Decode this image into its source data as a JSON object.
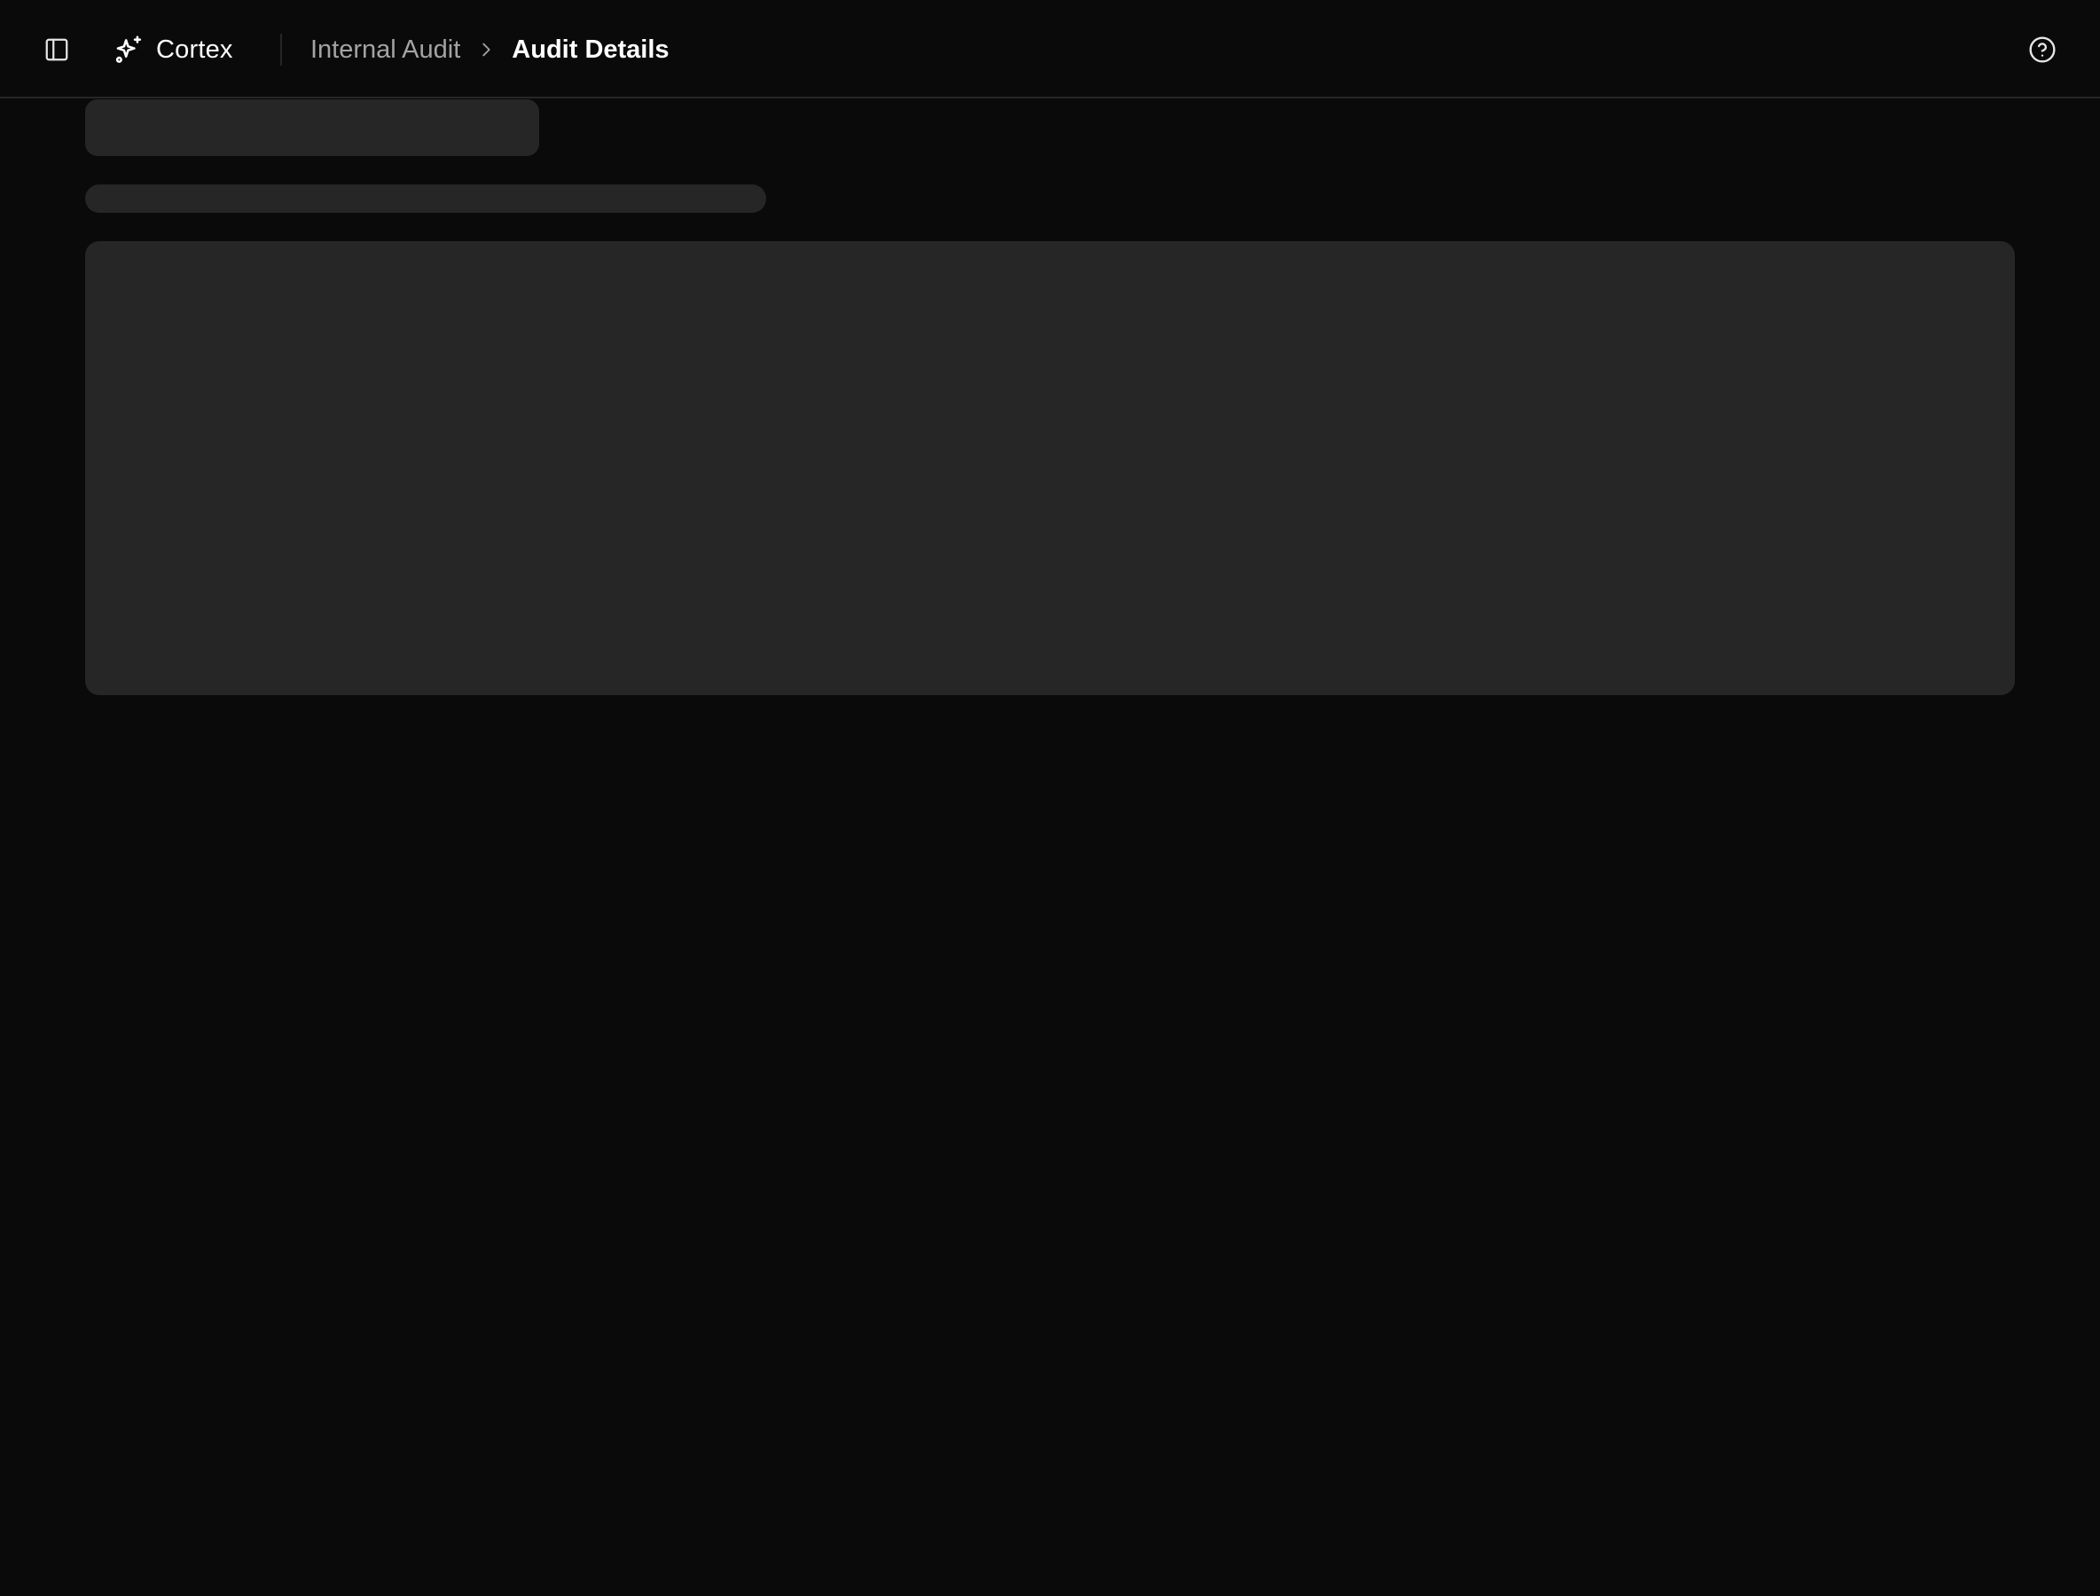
{
  "app": {
    "name": "Cortex",
    "brand_icon": "sparkles-icon"
  },
  "header": {
    "sidebar_toggle_icon": "panel-left-icon",
    "help_icon": "help-circle-icon",
    "breadcrumb": {
      "parent": "Internal Audit",
      "separator_icon": "chevron-right-icon",
      "current": "Audit Details"
    }
  },
  "colors": {
    "background": "#0a0a0a",
    "border": "#262626",
    "skeleton": "#262626",
    "text_primary": "#ffffff",
    "text_muted": "#a3a3a3"
  },
  "loading_state": true
}
